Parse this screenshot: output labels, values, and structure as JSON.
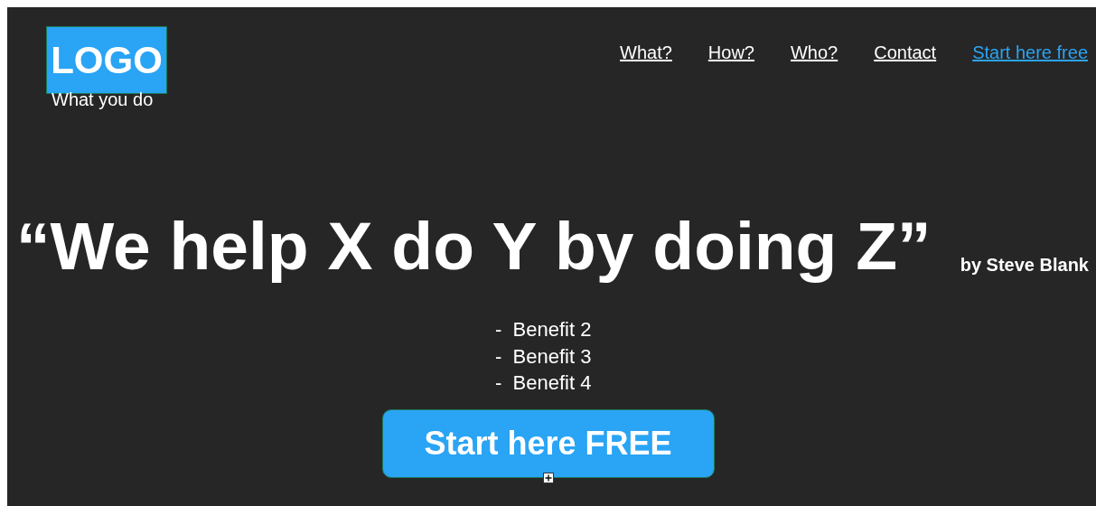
{
  "logo": {
    "text": "LOGO",
    "tagline": "What you do"
  },
  "nav": {
    "links": [
      {
        "label": "What?",
        "highlighted": false
      },
      {
        "label": "How?",
        "highlighted": false
      },
      {
        "label": "Who?",
        "highlighted": false
      },
      {
        "label": "Contact",
        "highlighted": false
      },
      {
        "label": "Start here free",
        "highlighted": true
      }
    ]
  },
  "hero": {
    "headline": "“We help X do Y by doing Z”",
    "attribution": "by Steve Blank",
    "benefits": [
      "-  Benefit 2",
      "-  Benefit 3",
      "-  Benefit 4"
    ],
    "cta": "Start here FREE"
  }
}
